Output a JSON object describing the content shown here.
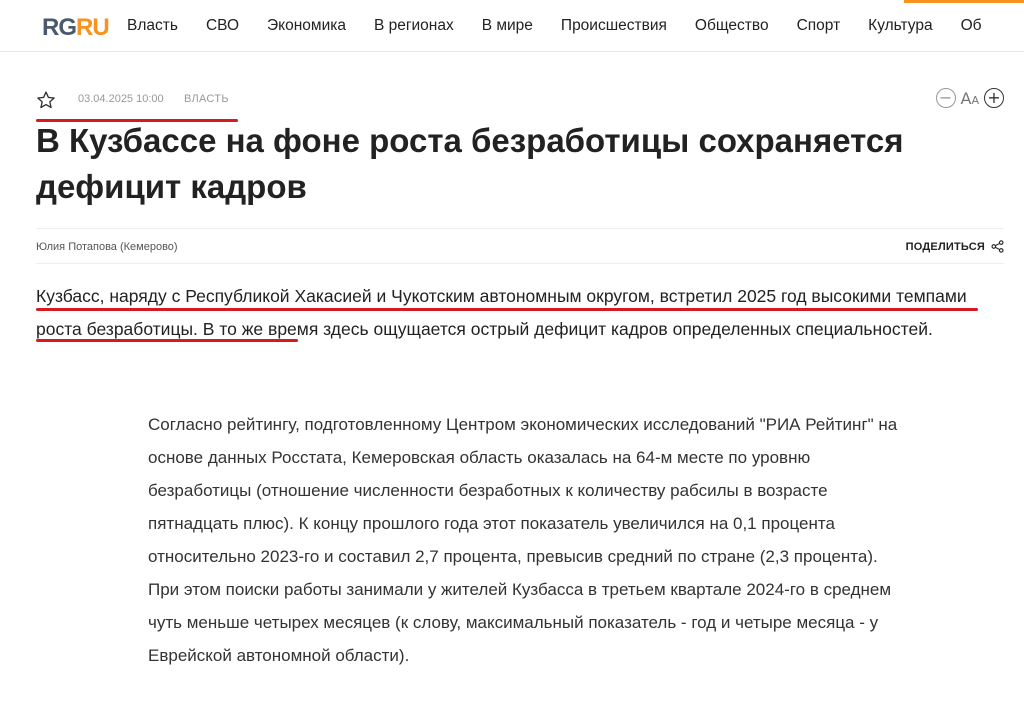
{
  "header": {
    "logo": {
      "rg": "RG",
      "ru": "RU"
    },
    "nav": [
      "Власть",
      "СВО",
      "Экономика",
      "В регионах",
      "В мире",
      "Происшествия",
      "Общество",
      "Спорт",
      "Культура",
      "Об"
    ]
  },
  "article": {
    "date": "03.04.2025 10:00",
    "rubric": "Власть",
    "title": "В Кузбассе на фоне роста безработицы сохраняется дефицит кадров",
    "author": "Юлия Потапова (Кемерово)",
    "share_label": "Поделиться",
    "font_control": {
      "label_big": "A",
      "label_small": "A",
      "minus": "−",
      "plus": "+"
    },
    "lead": "Кузбасс, наряду с Республикой Хакасией и Чукотским автономным округом, встретил 2025 год высокими темпами роста безработицы. В то же время здесь ощущается острый дефицит кадров определенных специальностей.",
    "body": "Согласно рейтингу, подготовленному Центром экономических исследований \"РИА Рейтинг\" на основе данных Росстата, Кемеровская область оказалась на 64-м месте по уровню безработицы (отношение численности безработных к количеству рабсилы в возрасте пятнадцать плюс). К концу прошлого года этот показатель увеличился на 0,1 процента относительно 2023-го и составил 2,7 процента, превысив средний по стране (2,3 процента). При этом поиски работы занимали у жителей Кузбасса в третьем квартале 2024-го в среднем чуть меньше четырех месяцев (к слову, максимальный показатель - год и четыре месяца - у Еврейской автономной области)."
  },
  "colors": {
    "accent": "#f7931e",
    "annotation": "#d71920",
    "logo_gray": "#4a5a6b"
  },
  "icons": [
    "star-icon",
    "font-decrease-icon",
    "font-increase-icon",
    "share-icon"
  ]
}
